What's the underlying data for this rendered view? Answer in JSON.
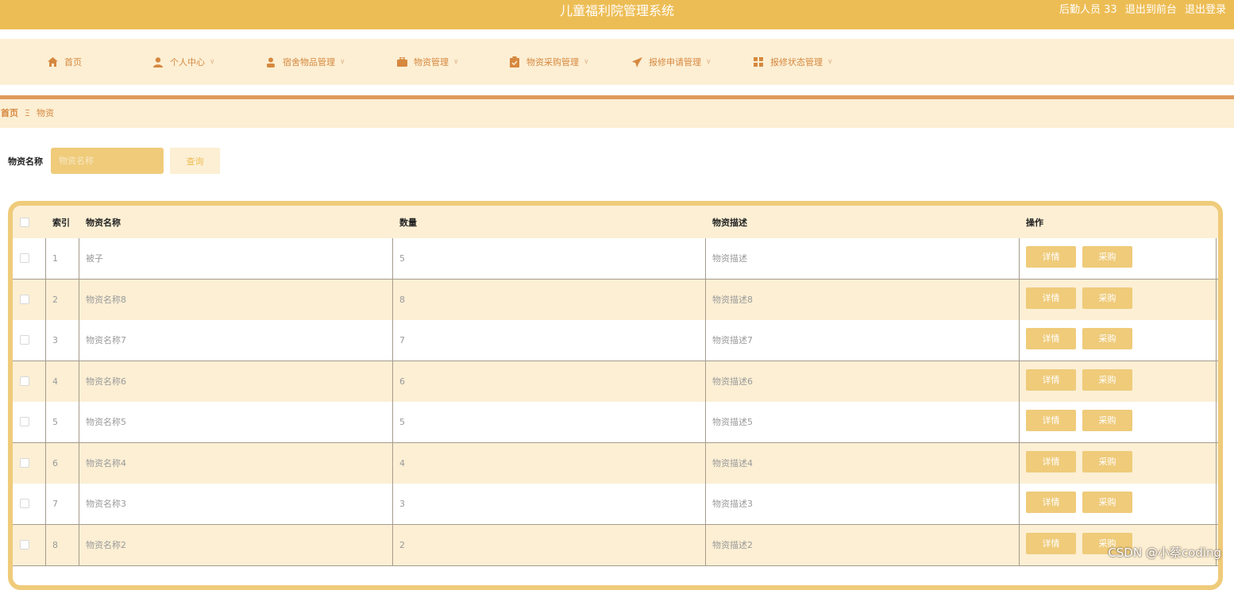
{
  "header": {
    "title": "儿童福利院管理系统",
    "user_label": "后勤人员 33",
    "to_front_link": "退出到前台",
    "logout_link": "退出登录"
  },
  "nav": [
    {
      "label": "首页",
      "icon": "home-icon",
      "has_dropdown": false
    },
    {
      "label": "个人中心",
      "icon": "user-icon",
      "has_dropdown": true
    },
    {
      "label": "宿舍物品管理",
      "icon": "person-icon",
      "has_dropdown": true
    },
    {
      "label": "物资管理",
      "icon": "briefcase-icon",
      "has_dropdown": true
    },
    {
      "label": "物资采购管理",
      "icon": "clipboard-icon",
      "has_dropdown": true
    },
    {
      "label": "报修申请管理",
      "icon": "send-icon",
      "has_dropdown": true
    },
    {
      "label": "报修状态管理",
      "icon": "grid-icon",
      "has_dropdown": true
    }
  ],
  "breadcrumb": {
    "home": "首页",
    "separator": "Ξ",
    "current": "物资"
  },
  "search": {
    "label": "物资名称",
    "placeholder": "物资名称",
    "button": "查询"
  },
  "table": {
    "headers": {
      "index": "索引",
      "name": "物资名称",
      "quantity": "数量",
      "description": "物资描述",
      "actions": "操作"
    },
    "rows": [
      {
        "index": "1",
        "name": "被子",
        "quantity": "5",
        "description": "物资描述"
      },
      {
        "index": "2",
        "name": "物资名称8",
        "quantity": "8",
        "description": "物资描述8"
      },
      {
        "index": "3",
        "name": "物资名称7",
        "quantity": "7",
        "description": "物资描述7"
      },
      {
        "index": "4",
        "name": "物资名称6",
        "quantity": "6",
        "description": "物资描述6"
      },
      {
        "index": "5",
        "name": "物资名称5",
        "quantity": "5",
        "description": "物资描述5"
      },
      {
        "index": "6",
        "name": "物资名称4",
        "quantity": "4",
        "description": "物资描述4"
      },
      {
        "index": "7",
        "name": "物资名称3",
        "quantity": "3",
        "description": "物资描述3"
      },
      {
        "index": "8",
        "name": "物资名称2",
        "quantity": "2",
        "description": "物资描述2"
      }
    ],
    "detail_button": "详情",
    "purchase_button": "采购"
  },
  "watermark": "CSDN @小蔡coding",
  "colors": {
    "primary": "#edbd55",
    "light": "#fcefd4",
    "accent": "#d6883f",
    "button": "#efcb7a"
  }
}
